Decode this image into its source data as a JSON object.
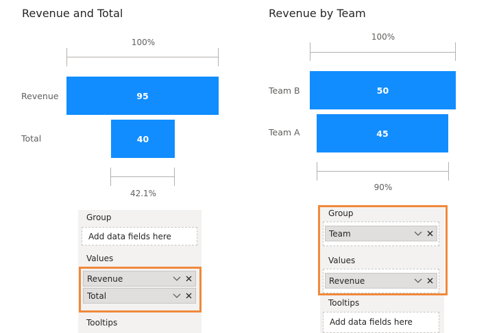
{
  "left_chart": {
    "title": "Revenue and Total",
    "top_percent": "100%",
    "bottom_percent": "42.1%"
  },
  "right_chart": {
    "title": "Revenue by Team",
    "top_percent": "100%",
    "bottom_percent": "90%"
  },
  "chart_data": [
    {
      "type": "bar",
      "orientation": "funnel",
      "title": "Revenue and Total",
      "categories": [
        "Revenue",
        "Total"
      ],
      "values": [
        95,
        40
      ],
      "data_labels": [
        "95",
        "40"
      ],
      "annotations": [
        "100%",
        "42.1%"
      ],
      "color": "#118dff"
    },
    {
      "type": "bar",
      "orientation": "funnel",
      "title": "Revenue by Team",
      "categories": [
        "Team B",
        "Team A"
      ],
      "values": [
        50,
        45
      ],
      "data_labels": [
        "50",
        "45"
      ],
      "annotations": [
        "100%",
        "90%"
      ],
      "color": "#118dff"
    }
  ],
  "left_pane": {
    "group_label": "Group",
    "group_placeholder": "Add data fields here",
    "values_label": "Values",
    "fields": [
      "Revenue",
      "Total"
    ],
    "tooltips_label": "Tooltips"
  },
  "right_pane": {
    "group_label": "Group",
    "group_field": "Team",
    "values_label": "Values",
    "values_field": "Revenue",
    "tooltips_label": "Tooltips",
    "tooltips_placeholder": "Add data fields here"
  },
  "colors": {
    "bar": "#118dff",
    "highlight": "#f0883a",
    "pane_background": "#f3f2f1"
  },
  "icons": [
    "chevron-down-icon",
    "close-icon"
  ]
}
